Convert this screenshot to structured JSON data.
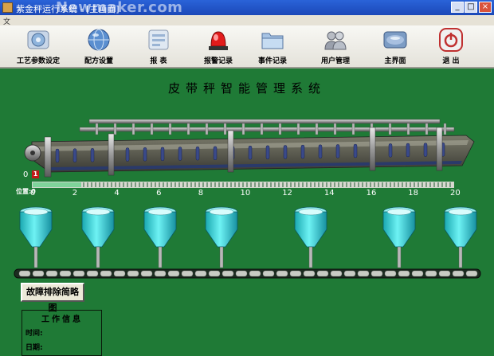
{
  "window": {
    "title": "紫金秤运行系统 - [主画面]",
    "watermark": "Newmaker.com",
    "minimize": "_",
    "maximize": "□",
    "close": "×"
  },
  "menu": {
    "file": "文"
  },
  "toolbar": [
    {
      "label": "工艺参数设定",
      "icon": "settings-icon"
    },
    {
      "label": "配方设置",
      "icon": "globe-icon"
    },
    {
      "label": "报  表",
      "icon": "report-icon"
    },
    {
      "label": "报警记录",
      "icon": "alarm-light-icon"
    },
    {
      "label": "事件记录",
      "icon": "folder-icon"
    },
    {
      "label": "用户管理",
      "icon": "users-icon"
    },
    {
      "label": "主界面",
      "icon": "home-icon"
    },
    {
      "label": "退  出",
      "icon": "power-icon"
    }
  ],
  "main": {
    "title": "皮带秤智能管理系统"
  },
  "conveyor": {
    "zero_label": "0",
    "marker_label": "1",
    "position_label": "位置:",
    "position_value": 0,
    "scale_max": 20,
    "ticks": [
      "0",
      "2",
      "4",
      "6",
      "8",
      "10",
      "12",
      "14",
      "16",
      "18",
      "20"
    ],
    "fill_fraction": 0.115
  },
  "hoppers": {
    "count": 7,
    "color": "#3fd0d4"
  },
  "fault_button": {
    "label": "故障排除简略图"
  },
  "work_info": {
    "title": "工作信息",
    "time_label": "时间:",
    "date_label": "日期:"
  }
}
